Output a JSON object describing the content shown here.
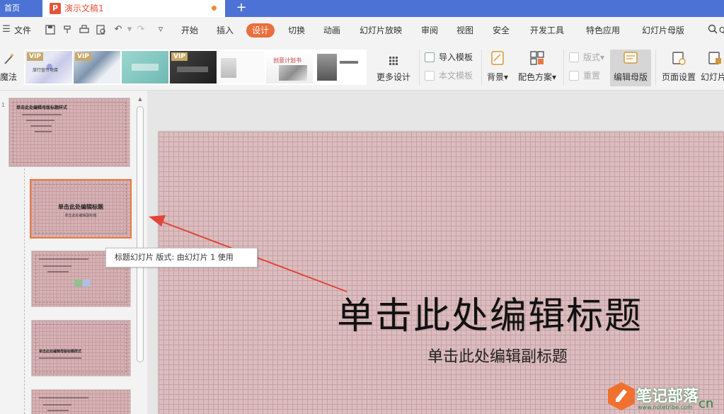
{
  "tabs": {
    "home": "首页",
    "document": "演示文稿1",
    "add": "+"
  },
  "menu": {
    "file": "文件",
    "items": [
      "开始",
      "插入",
      "设计",
      "切换",
      "动画",
      "幻灯片放映",
      "审阅",
      "视图",
      "安全",
      "开发工具",
      "特色应用",
      "幻灯片母版"
    ],
    "active": "设计",
    "search_partial": "Q"
  },
  "ribbon": {
    "magic_label": "魔法",
    "vip": "VIP",
    "more_design": "更多设计",
    "import_template": "导入模板",
    "body_template": "本文模板",
    "background": "背景",
    "color_scheme": "配色方案",
    "layout": "版式",
    "reset": "重置",
    "edit_master": "编辑母版",
    "page_setup": "页面设置",
    "slide_size_partial": "幻灯片",
    "thumb_captions": [
      "旅行宣传项目",
      "创意计划书"
    ]
  },
  "slides_panel": {
    "slide1_title": "单击此处编辑母版标题样式",
    "slide2_title": "单击此处编辑标题",
    "slide2_sub": "单击此处编辑副标题",
    "slide4_title": "单击此处编辑母版标题样式"
  },
  "tooltip": "标题幻灯片 版式: 由幻灯片 1 使用",
  "slide": {
    "title": "单击此处编辑标题",
    "subtitle": "单击此处编辑副标题"
  },
  "watermark": {
    "name": "笔记部落",
    "url": "www.notetribe.com",
    "suffix": "cn"
  },
  "colors": {
    "tab_bar": "#4b72d4",
    "accent": "#e96f3c",
    "slide_pink": "#dcbdbf",
    "arrow": "#e0453a"
  }
}
